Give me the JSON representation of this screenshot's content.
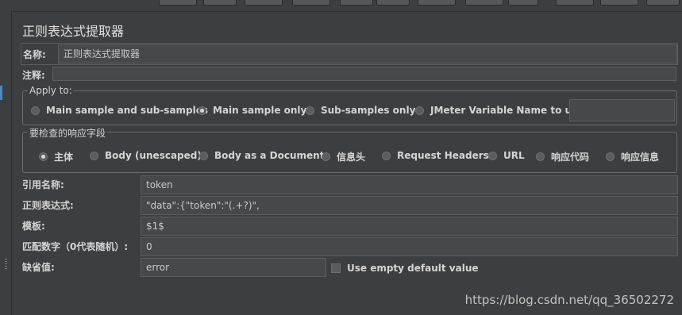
{
  "title": "正则表达式提取器",
  "name_label": "名称:",
  "name_value": "正则表达式提取器",
  "comment_label": "注释:",
  "comment_value": "",
  "apply_to": {
    "legend": "Apply to:",
    "options": [
      {
        "label": "Main sample and sub-samples",
        "selected": false
      },
      {
        "label": "Main sample only",
        "selected": true
      },
      {
        "label": "Sub-samples only",
        "selected": false
      },
      {
        "label": "JMeter Variable Name to use",
        "selected": false
      }
    ],
    "variable_value": ""
  },
  "response_field": {
    "legend": "要检查的响应字段",
    "options": [
      {
        "label": "主体",
        "selected": true
      },
      {
        "label": "Body (unescaped)",
        "selected": false
      },
      {
        "label": "Body as a Document",
        "selected": false
      },
      {
        "label": "信息头",
        "selected": false
      },
      {
        "label": "Request Headers",
        "selected": false
      },
      {
        "label": "URL",
        "selected": false
      },
      {
        "label": "响应代码",
        "selected": false
      },
      {
        "label": "响应信息",
        "selected": false
      }
    ]
  },
  "form": {
    "ref_name_label": "引用名称:",
    "ref_name_value": "token",
    "regex_label": "正则表达式:",
    "regex_value": "\"data\":{\"token\":\"(.+?)\",",
    "template_label": "模板:",
    "template_value": "$1$",
    "match_no_label": "匹配数字（0代表随机）:",
    "match_no_value": "0",
    "default_label": "缺省值:",
    "default_value": "error",
    "use_empty_label": "Use empty default value",
    "use_empty_checked": false
  },
  "watermark": "https://blog.csdn.net/qq_36502272"
}
